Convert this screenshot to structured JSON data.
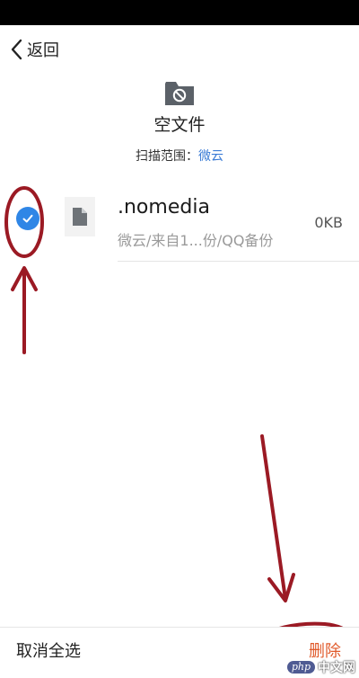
{
  "nav": {
    "back_label": "返回"
  },
  "header": {
    "title": "空文件",
    "scan_label": "扫描范围：",
    "scan_value": "微云"
  },
  "files": [
    {
      "name": ".nomedia",
      "path": "微云/来自1...份/QQ备份",
      "size": "0KB",
      "checked": true
    }
  ],
  "bottom_bar": {
    "deselect_label": "取消全选",
    "delete_label": "删除"
  },
  "watermark": {
    "logo": "php",
    "text": "中文网"
  },
  "colors": {
    "accent_blue": "#2f86e6",
    "delete_orange": "#e05a2b",
    "annotation_red": "#9b1a24"
  },
  "icons": {
    "back": "chevron-left-icon",
    "folder": "folder-blocked-icon",
    "check": "check-icon",
    "file": "file-icon"
  }
}
